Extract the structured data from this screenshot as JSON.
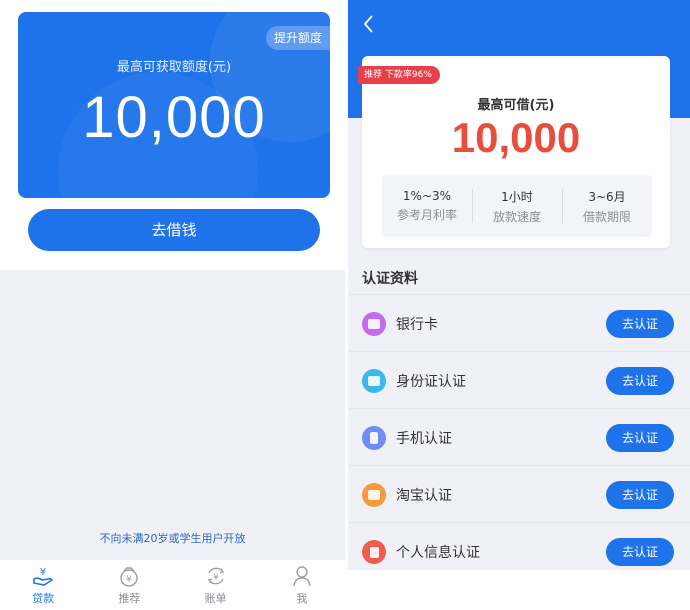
{
  "left": {
    "quota_card": {
      "raise_label": "提升额度",
      "title": "最高可获取额度(元)",
      "amount": "10,000"
    },
    "borrow_label": "去借钱",
    "notice": "不向未满20岁或学生用户开放",
    "tabs": [
      {
        "label": "贷款",
        "icon": "loan-icon",
        "active": true
      },
      {
        "label": "推荐",
        "icon": "recommend-icon",
        "active": false
      },
      {
        "label": "账单",
        "icon": "bill-icon",
        "active": false
      },
      {
        "label": "我",
        "icon": "user-icon",
        "active": false
      }
    ]
  },
  "right": {
    "header": {
      "back_icon": "chevron-left-icon"
    },
    "limit_card": {
      "badge_tag": "推荐",
      "badge_text": "下款率96%",
      "title": "最高可借(元)",
      "amount": "10,000",
      "stats": [
        {
          "value": "1%~3%",
          "label": "参考月利率"
        },
        {
          "value": "1小时",
          "label": "放款速度"
        },
        {
          "value": "3~6月",
          "label": "借款期限"
        }
      ]
    },
    "section_title": "认证资料",
    "auth_items": [
      {
        "label": "银行卡",
        "icon": "card-icon",
        "color": "#c36bf0",
        "button": "去认证"
      },
      {
        "label": "身份证认证",
        "icon": "id-card-icon",
        "color": "#3bb7ef",
        "button": "去认证"
      },
      {
        "label": "手机认证",
        "icon": "phone-icon",
        "color": "#6f8cf7",
        "button": "去认证"
      },
      {
        "label": "淘宝认证",
        "icon": "taobao-icon",
        "color": "#f59a3c",
        "button": "去认证"
      },
      {
        "label": "个人信息认证",
        "icon": "profile-icon",
        "color": "#f25c4d",
        "button": "去认证"
      }
    ]
  },
  "colors": {
    "primary": "#1f73ea",
    "accent_red": "#e84e3c",
    "badge_red": "#e8404a",
    "notice_blue": "#2e66c9"
  }
}
